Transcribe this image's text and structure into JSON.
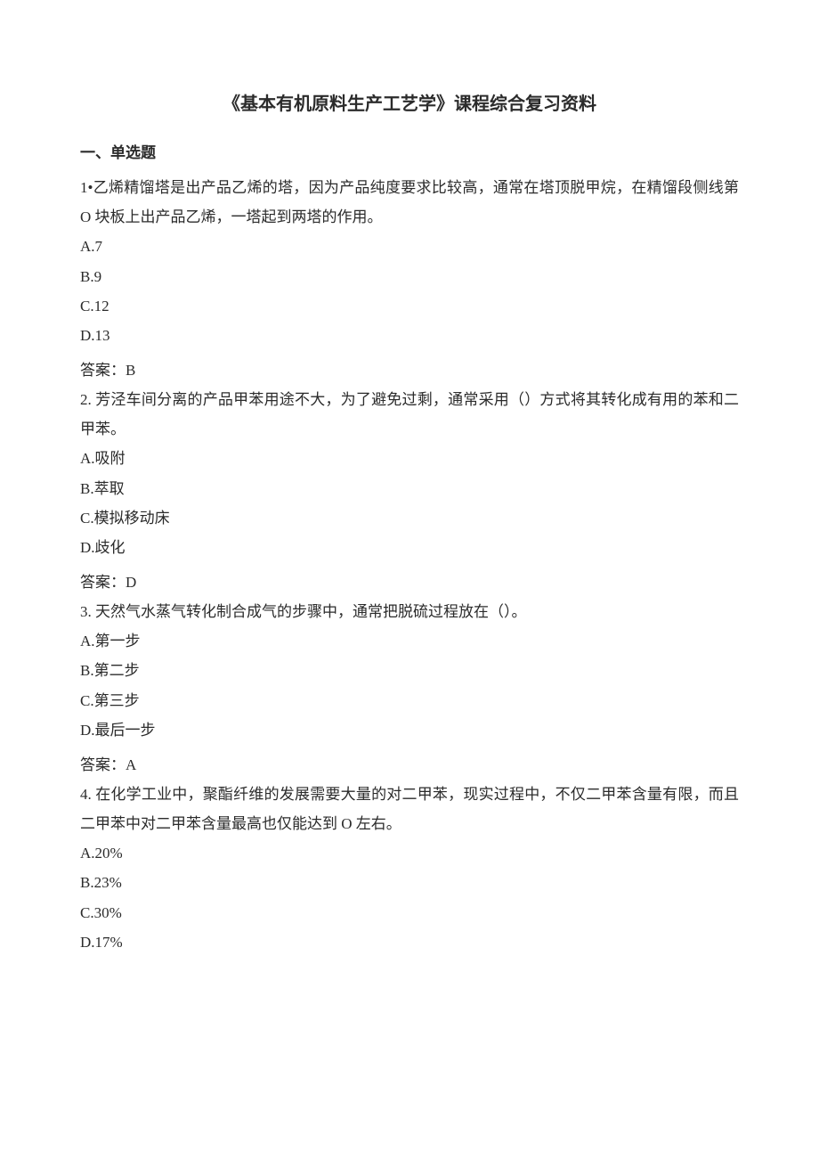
{
  "document": {
    "title": "《基本有机原料生产工艺学》课程综合复习资料",
    "section_heading": "一、单选题",
    "answer_label_prefix": "答案：",
    "questions": [
      {
        "stem": "1•乙烯精馏塔是出产品乙烯的塔，因为产品纯度要求比较高，通常在塔顶脱甲烷，在精馏段侧线第 O 块板上出产品乙烯，一塔起到两塔的作用。",
        "options": [
          {
            "label": "A.7"
          },
          {
            "label": "B.9"
          },
          {
            "label": "C.12"
          },
          {
            "label": "D.13"
          }
        ],
        "answer": "B"
      },
      {
        "stem": "2. 芳泾车间分离的产品甲苯用途不大，为了避免过剩，通常采用（）方式将其转化成有用的苯和二甲苯。",
        "options": [
          {
            "label": "A.吸附"
          },
          {
            "label": "B.萃取"
          },
          {
            "label": "C.模拟移动床"
          },
          {
            "label": "D.歧化"
          }
        ],
        "answer": "D"
      },
      {
        "stem": "3. 天然气水蒸气转化制合成气的步骤中，通常把脱硫过程放在（）。",
        "options": [
          {
            "label": "A.第一步"
          },
          {
            "label": "B.第二步"
          },
          {
            "label": "C.第三步"
          },
          {
            "label": "D.最后一步"
          }
        ],
        "answer": "A"
      },
      {
        "stem": "4. 在化学工业中，聚酯纤维的发展需要大量的对二甲苯，现实过程中，不仅二甲苯含量有限，而且二甲苯中对二甲苯含量最高也仅能达到 O 左右。",
        "options": [
          {
            "label": "A.20%"
          },
          {
            "label": "B.23%"
          },
          {
            "label": "C.30%"
          },
          {
            "label": "D.17%"
          }
        ],
        "answer": null
      }
    ]
  }
}
